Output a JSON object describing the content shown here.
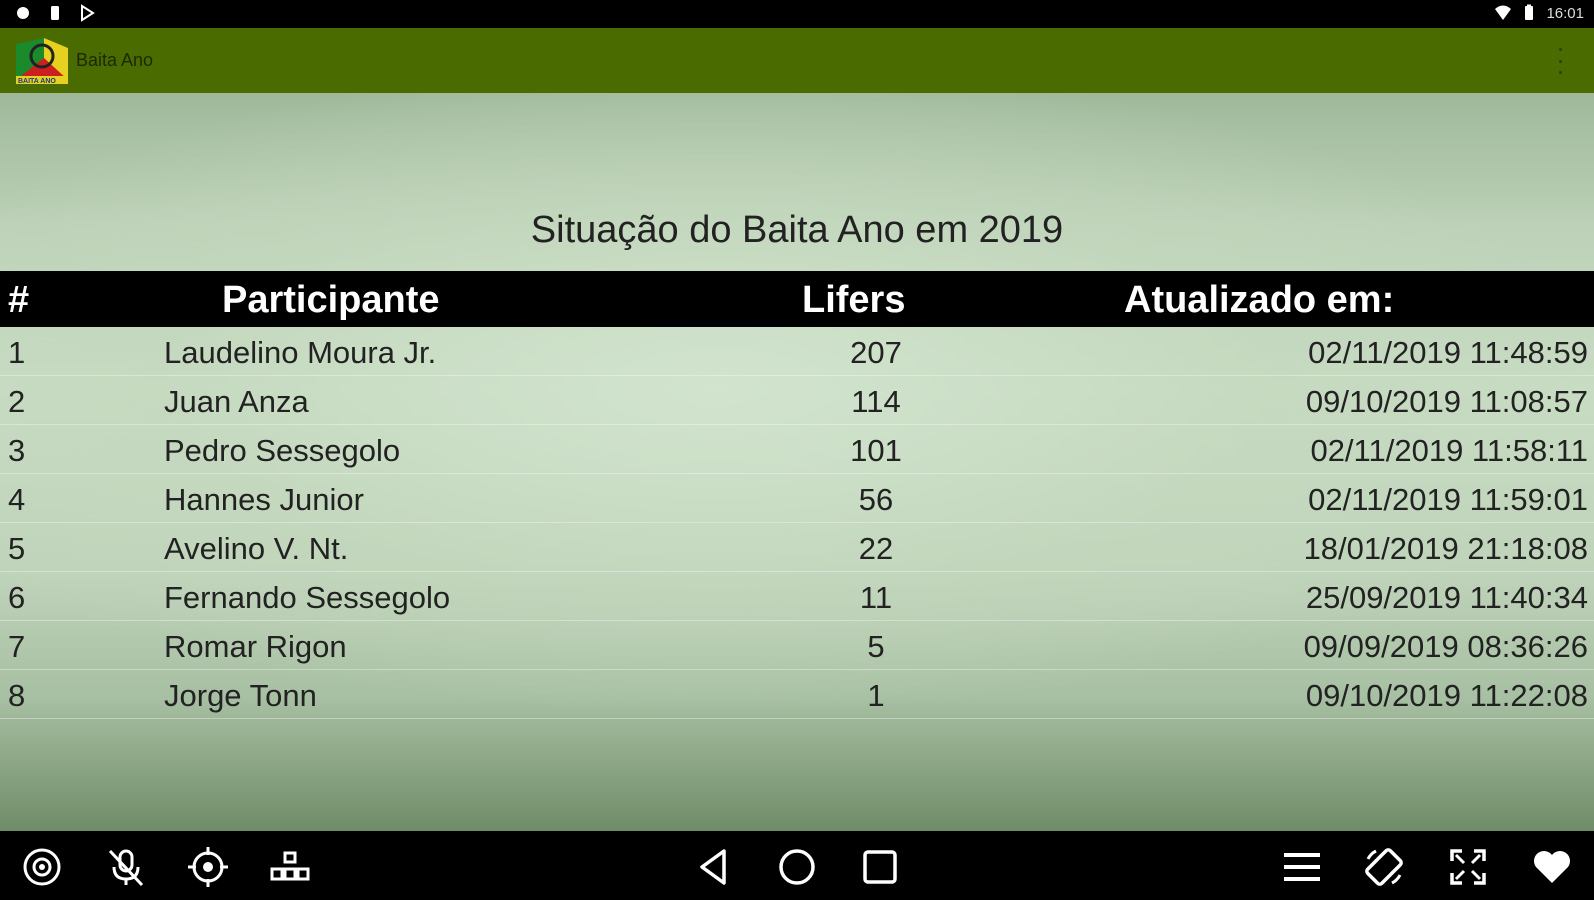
{
  "status_bar": {
    "time": "16:01"
  },
  "app_bar": {
    "title": "Baita Ano",
    "logo_caption": "BAITA ANO"
  },
  "main": {
    "page_title": "Situação do Baita Ano em 2019",
    "table": {
      "headers": {
        "rank": "#",
        "participant": "Participante",
        "lifers": "Lifers",
        "updated": "Atualizado em:"
      },
      "rows": [
        {
          "rank": "1",
          "name": "Laudelino Moura Jr.",
          "lifers": "207",
          "updated": "02/11/2019 11:48:59"
        },
        {
          "rank": "2",
          "name": "Juan Anza",
          "lifers": "114",
          "updated": "09/10/2019 11:08:57"
        },
        {
          "rank": "3",
          "name": "Pedro Sessegolo",
          "lifers": "101",
          "updated": "02/11/2019 11:58:11"
        },
        {
          "rank": "4",
          "name": "Hannes Junior",
          "lifers": "56",
          "updated": "02/11/2019 11:59:01"
        },
        {
          "rank": "5",
          "name": "Avelino V. Nt.",
          "lifers": "22",
          "updated": "18/01/2019 21:18:08"
        },
        {
          "rank": "6",
          "name": "Fernando Sessegolo",
          "lifers": "11",
          "updated": "25/09/2019 11:40:34"
        },
        {
          "rank": "7",
          "name": "Romar Rigon",
          "lifers": "5",
          "updated": "09/09/2019 08:36:26"
        },
        {
          "rank": "8",
          "name": "Jorge Tonn",
          "lifers": "1",
          "updated": "09/10/2019 11:22:08"
        }
      ]
    }
  },
  "nav_bar": {
    "icons": [
      "camera-icon",
      "mic-off-icon",
      "location-icon",
      "keymap-icon",
      "back-icon",
      "home-icon",
      "recents-icon",
      "menu-icon",
      "rotate-icon",
      "fullscreen-icon",
      "favorite-icon"
    ]
  },
  "colors": {
    "app_bar": "#4a6b00",
    "table_header": "#000000",
    "content_bg": "#c8dcc4"
  }
}
